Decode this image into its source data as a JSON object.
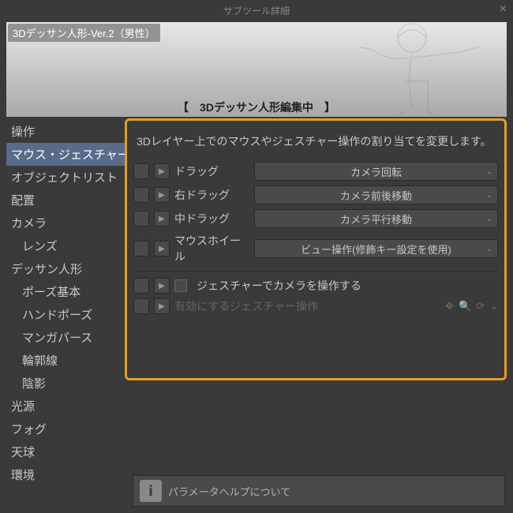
{
  "window": {
    "title": "サブツール詳細",
    "close_glyph": "×"
  },
  "preview": {
    "tool_name": "3Dデッサン人形-Ver.2（男性）",
    "edit_banner": "【　3Dデッサン人形編集中　】"
  },
  "sidebar": {
    "items": [
      {
        "label": "操作",
        "indent": false,
        "selected": false
      },
      {
        "label": "マウス・ジェスチャー",
        "indent": false,
        "selected": true
      },
      {
        "label": "オブジェクトリスト",
        "indent": false,
        "selected": false
      },
      {
        "label": "配置",
        "indent": false,
        "selected": false
      },
      {
        "label": "カメラ",
        "indent": false,
        "selected": false
      },
      {
        "label": "レンズ",
        "indent": true,
        "selected": false
      },
      {
        "label": "デッサン人形",
        "indent": false,
        "selected": false
      },
      {
        "label": "ポーズ基本",
        "indent": true,
        "selected": false
      },
      {
        "label": "ハンドポーズ",
        "indent": true,
        "selected": false
      },
      {
        "label": "マンガパース",
        "indent": true,
        "selected": false
      },
      {
        "label": "輪郭線",
        "indent": true,
        "selected": false
      },
      {
        "label": "陰影",
        "indent": true,
        "selected": false
      },
      {
        "label": "光源",
        "indent": false,
        "selected": false
      },
      {
        "label": "フォグ",
        "indent": false,
        "selected": false
      },
      {
        "label": "天球",
        "indent": false,
        "selected": false
      },
      {
        "label": "環境",
        "indent": false,
        "selected": false
      }
    ]
  },
  "panel": {
    "description": "3Dレイヤー上でのマウスやジェスチャー操作の割り当てを変更します。",
    "rows": [
      {
        "label": "ドラッグ",
        "value": "カメラ回転"
      },
      {
        "label": "右ドラッグ",
        "value": "カメラ前後移動"
      },
      {
        "label": "中ドラッグ",
        "value": "カメラ平行移動"
      },
      {
        "label": "マウスホイール",
        "value": "ビュー操作(修飾キー設定を使用)"
      }
    ],
    "gesture_checkbox_label": "ジェスチャーでカメラを操作する",
    "gesture_ops_label": "有効にするジェスチャー操作",
    "play_glyph": "▶"
  },
  "help": {
    "text": "パラメータヘルプについて"
  }
}
